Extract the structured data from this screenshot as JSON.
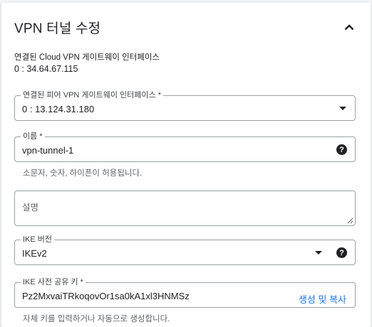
{
  "header": {
    "title": "VPN 터널 수정",
    "collapse_icon": "chevron-up-icon"
  },
  "cloud_gateway": {
    "label": "연결된 Cloud VPN 게이트웨이 인터페이스",
    "value": "0 : 34.64.67.115"
  },
  "peer_gateway": {
    "label": "연결된 피어 VPN 게이트웨이 인터페이스 *",
    "value": "0 : 13.124.31.180"
  },
  "name": {
    "label": "이름 *",
    "value": "vpn-tunnel-1",
    "hint": "소문자, 숫자, 하이픈이 허용됩니다."
  },
  "description": {
    "placeholder": "설명",
    "value": ""
  },
  "ike_version": {
    "label": "IKE 버전",
    "value": "IKEv2"
  },
  "ike_key": {
    "label": "IKE 사전 공유 키 *",
    "value": "Pz2MxvaiTRkoqovOr1sa0kA1xl3HNMSz",
    "generate_label": "생성 및 복사",
    "hint": "자체 키를 입력하거나 자동으로 생성합니다."
  },
  "colors": {
    "accent": "#1a73e8",
    "border": "#9aa0a6",
    "text": "#202124",
    "muted": "#5f6368"
  }
}
